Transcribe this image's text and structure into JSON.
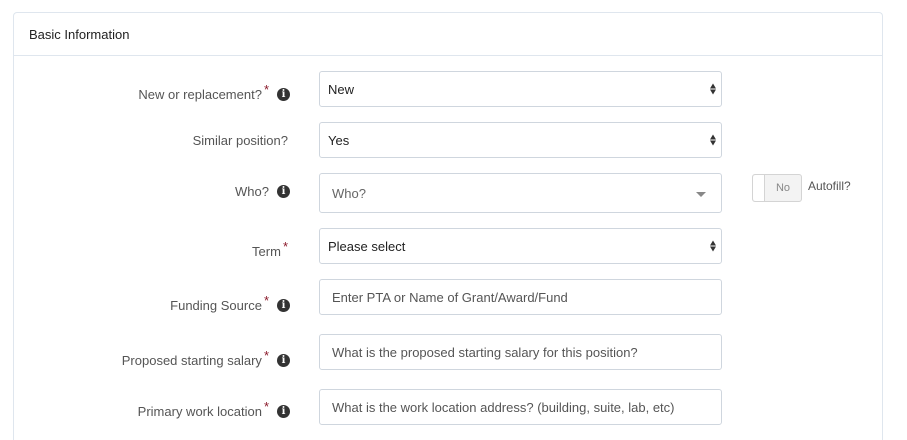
{
  "panel": {
    "title": "Basic Information"
  },
  "fields": {
    "new_or_replacement": {
      "label": "New or replacement?",
      "required": "*",
      "value": "New"
    },
    "similar_position": {
      "label": "Similar position?",
      "value": "Yes"
    },
    "who": {
      "label": "Who?",
      "placeholder": "Who?",
      "toggle_label": "No",
      "autofill_label": "Autofill?"
    },
    "term": {
      "label": "Term",
      "required": "*",
      "value": "Please select"
    },
    "funding_source": {
      "label": "Funding Source",
      "required": "*",
      "placeholder": "Enter PTA or Name of Grant/Award/Fund"
    },
    "starting_salary": {
      "label": "Proposed starting salary",
      "required": "*",
      "placeholder": "What is the proposed starting salary for this position?"
    },
    "work_location": {
      "label": "Primary work location",
      "required": "*",
      "placeholder": "What is the work location address? (building, suite, lab, etc)"
    }
  },
  "icons": {
    "info": "info-icon",
    "select": "select-arrows-icon",
    "dropdown": "chevron-down-icon"
  },
  "colors": {
    "required": "#8b1a2b",
    "border": "#cfd6de"
  }
}
